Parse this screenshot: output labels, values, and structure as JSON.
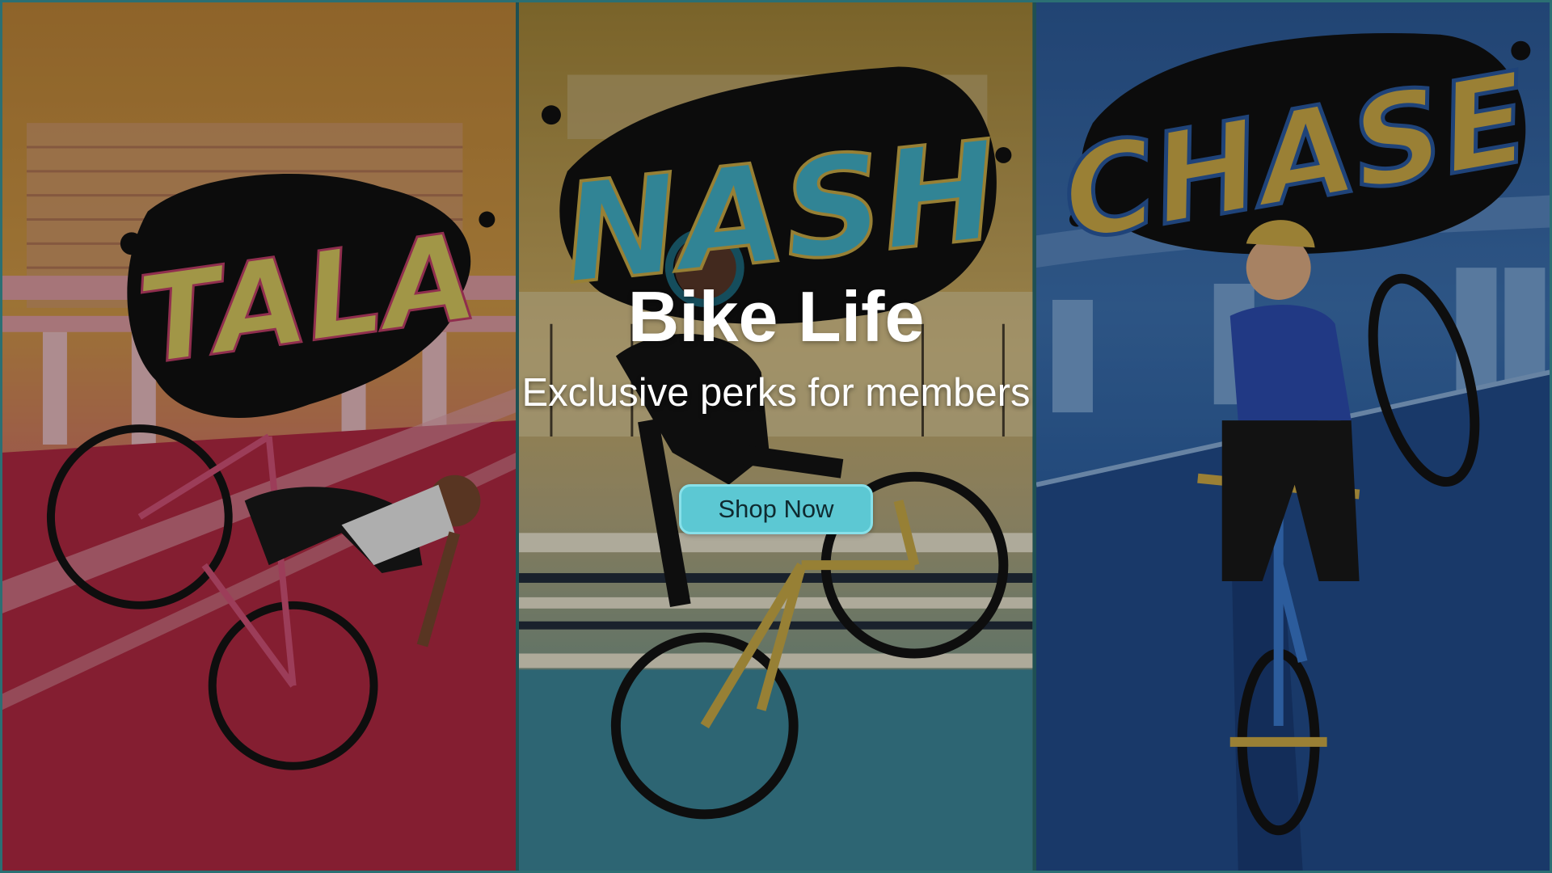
{
  "hero": {
    "title": "Bike Life",
    "subtitle": "Exclusive perks for members",
    "cta_label": "Shop Now"
  },
  "panels": [
    {
      "id": "tala",
      "label": "TALA",
      "accent": "#e0d063",
      "theme": "#c7425c"
    },
    {
      "id": "nash",
      "label": "NASH",
      "accent": "#45b7cf",
      "theme": "#d8a65a"
    },
    {
      "id": "chase",
      "label": "CHASE",
      "accent": "#d6b24a",
      "theme": "#2e5fa4"
    }
  ],
  "colors": {
    "button": "#5cc8d3",
    "frame": "#2b6f73"
  }
}
